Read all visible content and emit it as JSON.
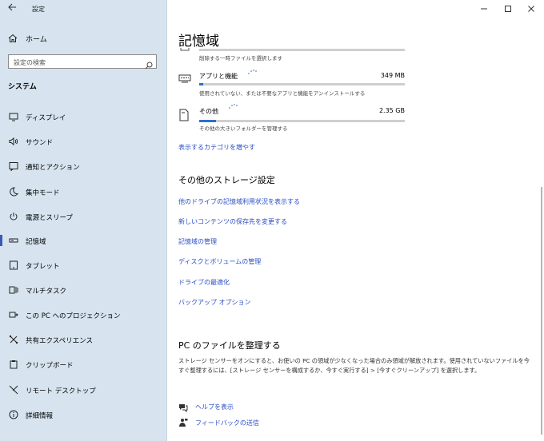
{
  "window": {
    "title": "設定"
  },
  "sidebar": {
    "home_label": "ホーム",
    "search_placeholder": "設定の検索",
    "section_title": "システム",
    "items": [
      {
        "label": "ディスプレイ",
        "icon": "display-icon"
      },
      {
        "label": "サウンド",
        "icon": "sound-icon"
      },
      {
        "label": "通知とアクション",
        "icon": "notification-icon"
      },
      {
        "label": "集中モード",
        "icon": "moon-icon"
      },
      {
        "label": "電源とスリープ",
        "icon": "power-icon"
      },
      {
        "label": "記憶域",
        "icon": "storage-icon",
        "selected": true
      },
      {
        "label": "タブレット",
        "icon": "tablet-icon"
      },
      {
        "label": "マルチタスク",
        "icon": "multitask-icon"
      },
      {
        "label": "この PC へのプロジェクション",
        "icon": "projection-icon"
      },
      {
        "label": "共有エクスペリエンス",
        "icon": "share-experience-icon"
      },
      {
        "label": "クリップボード",
        "icon": "clipboard-icon"
      },
      {
        "label": "リモート デスクトップ",
        "icon": "remote-desktop-icon"
      },
      {
        "label": "詳細情報",
        "icon": "info-icon"
      }
    ]
  },
  "main": {
    "title": "記憶域",
    "partial_item": {
      "description": "削除する一時ファイルを選択します"
    },
    "storage_items": [
      {
        "label": "アプリと機能",
        "size": "349 MB",
        "description": "使用されていない、または不要なアプリと機能をアンインストールする",
        "fill": 0.02
      },
      {
        "label": "その他",
        "size": "2.35 GB",
        "description": "その他の大きいフォルダーを管理する",
        "fill": 0.08
      }
    ],
    "show_more_link": "表示するカテゴリを増やす",
    "other_settings": {
      "heading": "その他のストレージ設定",
      "links": [
        "他のドライブの記憶域利用状況を表示する",
        "新しいコンテンツの保存先を変更する",
        "記憶域の管理",
        "ディスクとボリュームの管理",
        "ドライブの最適化",
        "バックアップ オプション"
      ]
    },
    "cleanup": {
      "heading": "PC のファイルを整理する",
      "text": "ストレージ センサーをオンにすると、お使いの PC の領域が少なくなった場合のみ領域が解放されます。使用されていないファイルを今すぐ整理するには、[ストレージ センサーを構成するか、今すぐ実行する] > [今すぐクリーンアップ] を選択します。"
    },
    "help_link": "ヘルプを表示",
    "feedback_link": "フィードバックの送信"
  },
  "colors": {
    "sidebar_bg": "#d7e4ef",
    "accent": "#2e6fc8",
    "link": "#2b4dc4"
  }
}
